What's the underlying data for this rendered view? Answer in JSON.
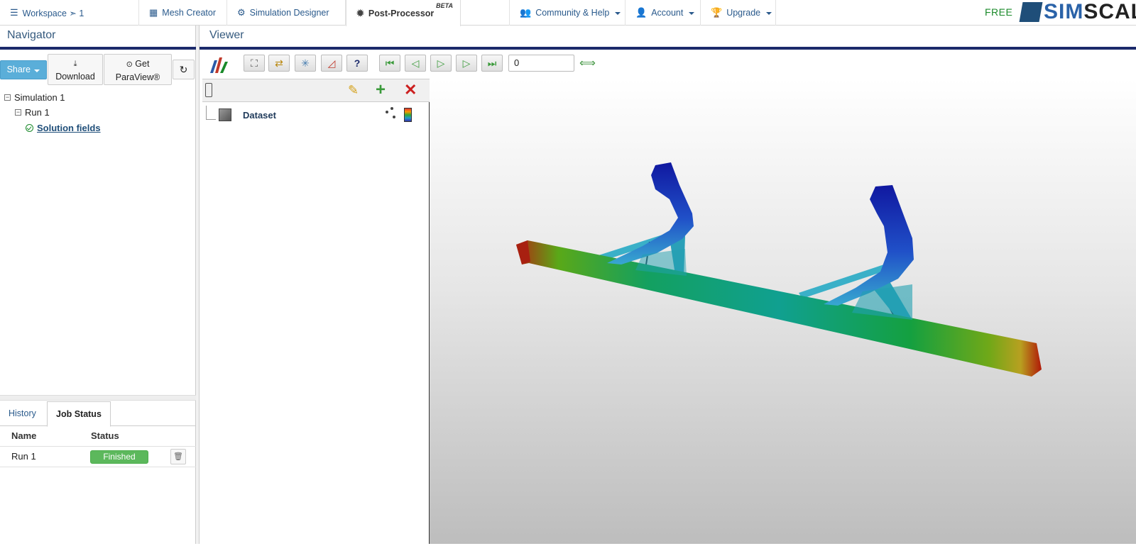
{
  "topnav": {
    "tabs": [
      {
        "label": "Workspace ➣ 1",
        "icon": "workspace-icon"
      },
      {
        "label": "Mesh Creator",
        "icon": "grid-icon"
      },
      {
        "label": "Simulation Designer",
        "icon": "gears-icon"
      },
      {
        "label": "Post-Processor",
        "icon": "gear-icon",
        "badge": "BETA",
        "active": true
      },
      {
        "label": "Community & Help",
        "icon": "users-icon"
      },
      {
        "label": "Account",
        "icon": "user-icon"
      },
      {
        "label": "Upgrade",
        "icon": "trophy-icon"
      }
    ],
    "plan": "FREE",
    "logo_sim": "SIM",
    "logo_scale": "SCALE"
  },
  "navigator": {
    "title": "Navigator",
    "share_label": "Share",
    "download_label": "Download",
    "get_label": "Get",
    "paraview_label": "ParaView®",
    "tree": [
      {
        "label": "Simulation 1"
      },
      {
        "label": "Run 1"
      },
      {
        "label": "Solution fields"
      }
    ]
  },
  "lower_panel": {
    "tabs": [
      "History",
      "Job Status"
    ],
    "active_tab": "Job Status",
    "columns": [
      "Name",
      "Status"
    ],
    "rows": [
      {
        "name": "Run 1",
        "status": "Finished"
      }
    ]
  },
  "viewer": {
    "title": "Viewer",
    "frame_value": "0",
    "pipeline_item": "Dataset"
  },
  "colors": {
    "accent": "#1b2a6b",
    "share": "#5aaed9",
    "finished": "#5cb85c",
    "link": "#2a5a8c"
  }
}
